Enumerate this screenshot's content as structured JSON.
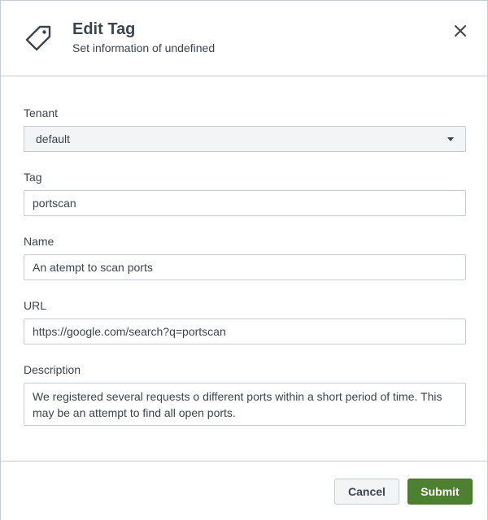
{
  "header": {
    "title": "Edit Tag",
    "subtitle": "Set information of undefined"
  },
  "form": {
    "tenant": {
      "label": "Tenant",
      "value": "default"
    },
    "tag": {
      "label": "Tag",
      "value": "portscan"
    },
    "name": {
      "label": "Name",
      "value": "An atempt to scan ports"
    },
    "url": {
      "label": "URL",
      "value": "https://google.com/search?q=portscan"
    },
    "description": {
      "label": "Description",
      "value": "We registered several requests o different ports within a short period of time. This may be an attempt to find all open ports."
    }
  },
  "footer": {
    "cancel_label": "Cancel",
    "submit_label": "Submit"
  },
  "colors": {
    "submit": "#4e8032",
    "border": "#c3cbd4",
    "text": "#3c444d"
  },
  "icons": {
    "header": "tag-icon",
    "close": "close-icon",
    "dropdown": "caret-down-icon"
  }
}
